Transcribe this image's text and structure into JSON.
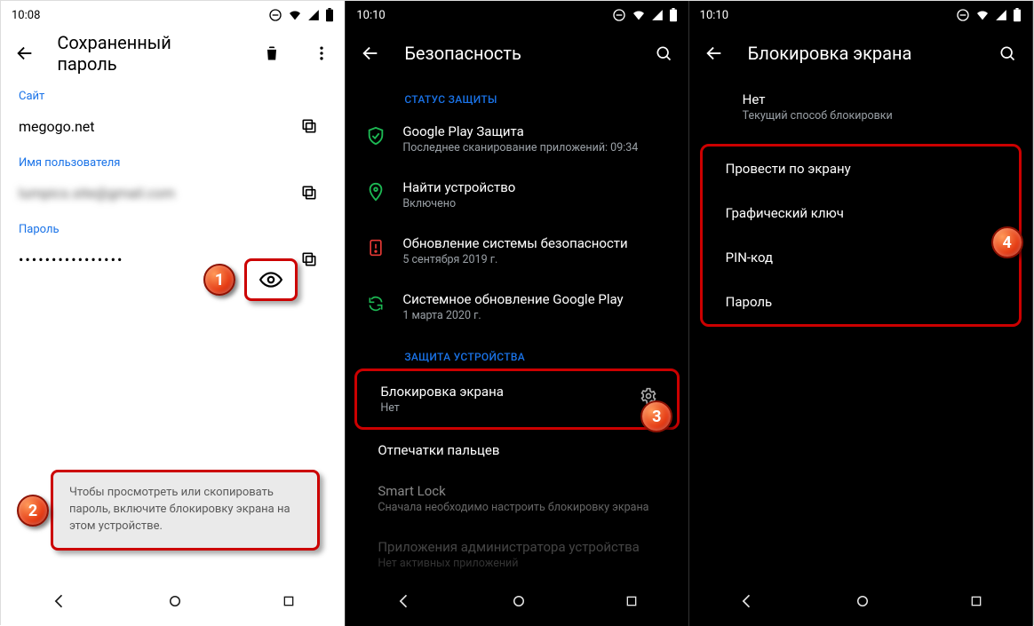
{
  "markers": {
    "m1": "1",
    "m2": "2",
    "m3": "3",
    "m4": "4"
  },
  "phone1": {
    "time": "10:08",
    "title": "Сохраненный пароль",
    "site_label": "Сайт",
    "site_value": "megogo.net",
    "user_label": "Имя пользователя",
    "user_value": "lumpics.site@gmail.com",
    "pass_label": "Пароль",
    "pass_value": "••••••••••••••••",
    "toast": "Чтобы просмотреть или скопировать пароль, включите блокировку экрана на этом устройстве."
  },
  "phone2": {
    "time": "10:10",
    "title": "Безопасность",
    "section_status": "СТАТУС ЗАЩИТЫ",
    "gpp": {
      "t": "Google Play Защита",
      "s": "Последнее сканирование приложений: 09:34"
    },
    "find": {
      "t": "Найти устройство",
      "s": "Включено"
    },
    "secupd": {
      "t": "Обновление системы безопасности",
      "s": "5 сентября 2019 г."
    },
    "gpsys": {
      "t": "Системное обновление Google Play",
      "s": "1 марта 2020 г."
    },
    "section_device": "ЗАЩИТА УСТРОЙСТВА",
    "lock": {
      "t": "Блокировка экрана",
      "s": "Нет"
    },
    "finger": {
      "t": "Отпечатки пальцев"
    },
    "smart": {
      "t": "Smart Lock",
      "s": "Сначала необходимо настроить блокировку экрана"
    },
    "admin": {
      "t": "Приложения администратора устройства",
      "s": "Нет активных приложений"
    }
  },
  "phone3": {
    "time": "10:10",
    "title": "Блокировка экрана",
    "none": {
      "t": "Нет",
      "s": "Текущий способ блокировки"
    },
    "opts": [
      "Провести по экрану",
      "Графический ключ",
      "PIN-код",
      "Пароль"
    ]
  }
}
